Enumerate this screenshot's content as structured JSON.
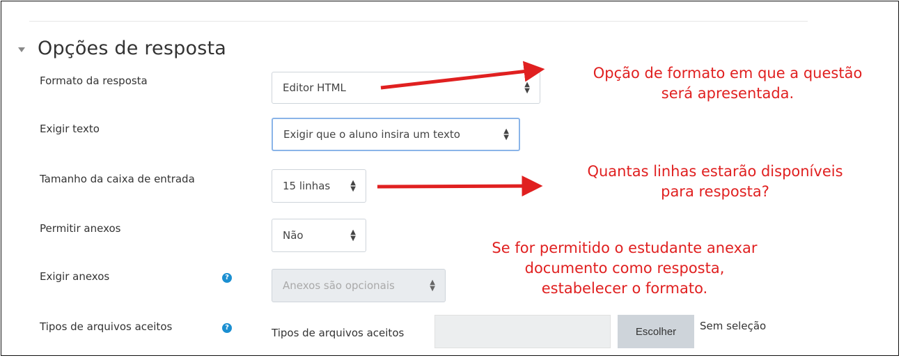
{
  "section": {
    "title": "Opções de resposta"
  },
  "fields": {
    "formato": {
      "label": "Formato da resposta",
      "value": "Editor HTML"
    },
    "exigir_texto": {
      "label": "Exigir texto",
      "value": "Exigir que o aluno insira um texto"
    },
    "tamanho": {
      "label": "Tamanho da caixa de entrada",
      "value": "15 linhas"
    },
    "permitir_anexos": {
      "label": "Permitir anexos",
      "value": "Não"
    },
    "exigir_anexos": {
      "label": "Exigir anexos",
      "value": "Anexos são opcionais"
    },
    "tipos_arquivos": {
      "label": "Tipos de arquivos aceitos",
      "inline_label": "Tipos de arquivos aceitos",
      "button": "Escolher",
      "status": "Sem seleção"
    }
  },
  "annotations": {
    "formato": [
      "Opção de formato em que a questão",
      "será apresentada."
    ],
    "linhas": [
      "Quantas linhas estarão disponíveis",
      "para resposta?"
    ],
    "anexos": [
      "Se for permitido o estudante anexar",
      "documento como resposta,",
      "estabelecer o formato."
    ]
  },
  "colors": {
    "annotation": "#e02020",
    "help_icon": "#1b8fd1"
  },
  "icons": {
    "help": "question-circle-icon",
    "select": "sort-arrows-icon",
    "section_toggle": "caret-down-icon"
  }
}
